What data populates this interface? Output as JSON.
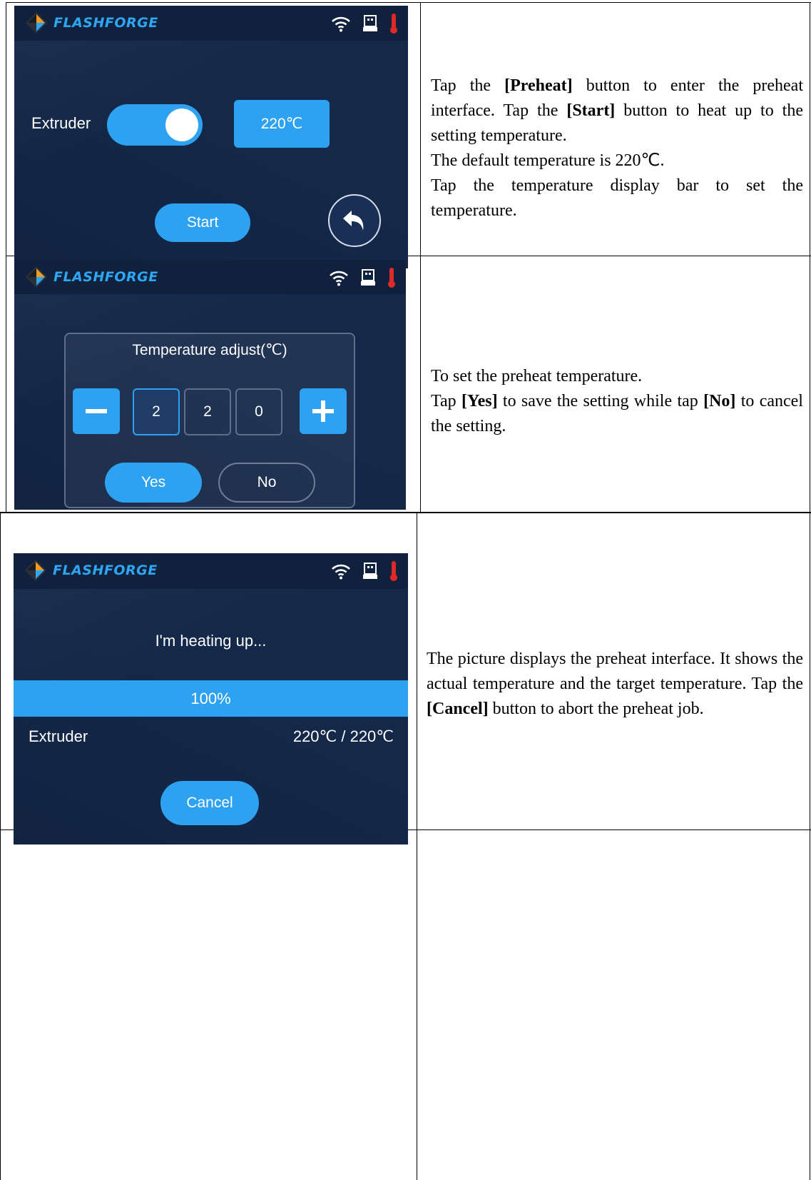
{
  "brand": {
    "name": "FLASHFORGE"
  },
  "icons": {
    "logo": "flashforge-logo-icon",
    "wifi": "wifi-icon",
    "usb": "usb-icon",
    "thermometer": "thermometer-icon",
    "back": "back-arrow-icon",
    "minus": "minus-icon",
    "plus": "plus-icon"
  },
  "colors": {
    "accent": "#2ea2f0",
    "screen_bg": "#14284a",
    "topbar_bg": "#0f213d",
    "thermo": "#e02a2a"
  },
  "row1": {
    "screen": {
      "extruder_label": "Extruder",
      "toggle_on": true,
      "temp_value": "220℃",
      "start_label": "Start"
    },
    "desc": {
      "p1_a": "Tap the ",
      "p1_b": "[Preheat]",
      "p1_c": " button to enter the preheat interface. Tap the ",
      "p1_d": "[Start]",
      "p1_e": " button to heat up to the setting temperature.",
      "p2": "The default temperature is 220℃.",
      "p3": "Tap the temperature display bar to set the temperature."
    }
  },
  "row2": {
    "screen": {
      "dialog_title": "Temperature adjust(℃)",
      "digits": [
        "2",
        "2",
        "0"
      ],
      "minus_label": "−",
      "plus_label": "+",
      "yes_label": "Yes",
      "no_label": "No"
    },
    "desc": {
      "p1": "To set the preheat temperature.",
      "p2_a": "Tap ",
      "p2_b": "[Yes]",
      "p2_c": " to save the setting while tap ",
      "p2_d": "[No]",
      "p2_e": " to cancel the setting."
    }
  },
  "row3": {
    "screen": {
      "status": "I'm heating up...",
      "progress": "100%",
      "progress_fraction": 1.0,
      "extruder_label": "Extruder",
      "temp_readout": "220℃ / 220℃",
      "cancel_label": "Cancel"
    },
    "desc": {
      "p1_a": "The picture displays the preheat interface. It shows the actual temperature and the target temperature. Tap the ",
      "p1_b": "[Cancel]",
      "p1_c": " button to abort the preheat job."
    }
  }
}
